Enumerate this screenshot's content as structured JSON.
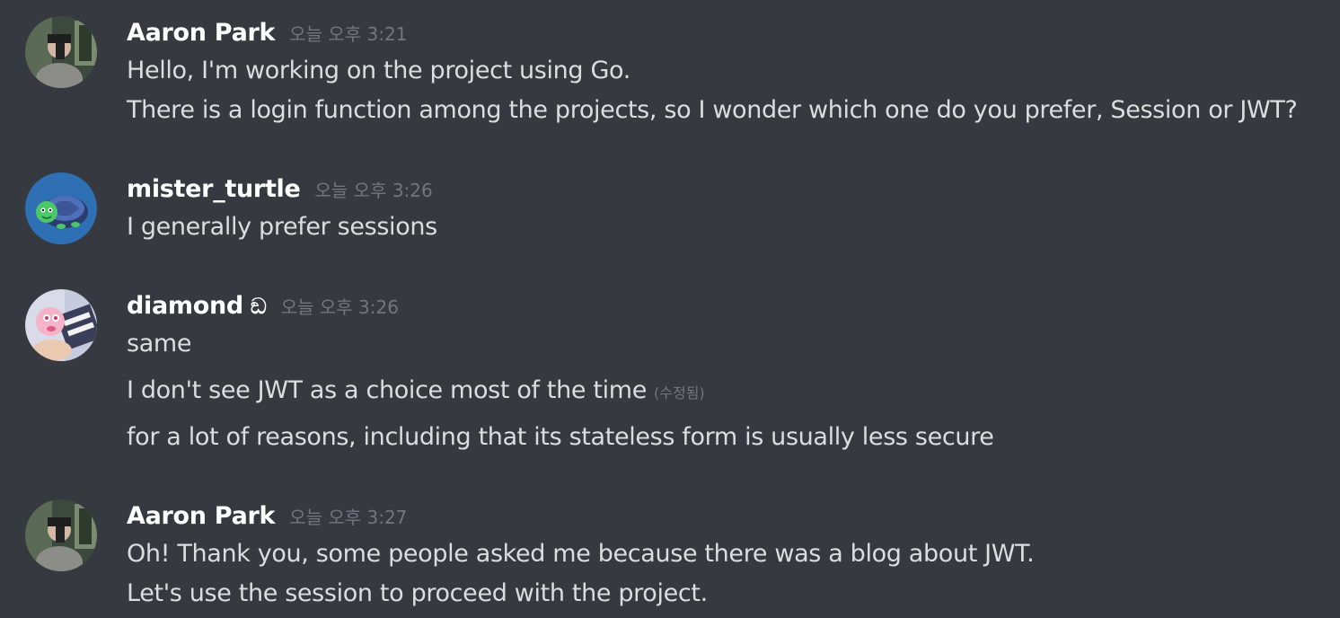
{
  "messages": [
    {
      "author": "Aaron Park",
      "timestamp": "오늘 오후 3:21",
      "avatar_icon": "user-photo-avatar",
      "lines": [
        "Hello, I'm working on the project using Go.",
        "There is a login function among the projects, so I wonder which one do you prefer, Session or JWT?"
      ]
    },
    {
      "author": "mister_turtle",
      "timestamp": "오늘 오후 3:26",
      "avatar_icon": "turtle-avatar",
      "lines": [
        "I generally prefer sessions"
      ]
    },
    {
      "author": "diamond",
      "author_glyph": "ඞ",
      "timestamp": "오늘 오후 3:26",
      "avatar_icon": "anime-avatar",
      "lines": [
        "same",
        "I don't see JWT as a choice most of the time",
        "for a lot of reasons, including that its stateless form is usually less secure"
      ],
      "edited_label": "(수정됨)"
    },
    {
      "author": "Aaron Park",
      "timestamp": "오늘 오후 3:27",
      "avatar_icon": "user-photo-avatar",
      "lines": [
        "Oh! Thank you, some people asked me because there was a blog about JWT.",
        "Let's use the session to proceed with the project."
      ]
    }
  ],
  "colors": {
    "background": "#36393f",
    "username": "#ffffff",
    "message_text": "#dcddde",
    "timestamp": "#72767d",
    "turtle_avatar_bg": "#2f6fb3"
  }
}
